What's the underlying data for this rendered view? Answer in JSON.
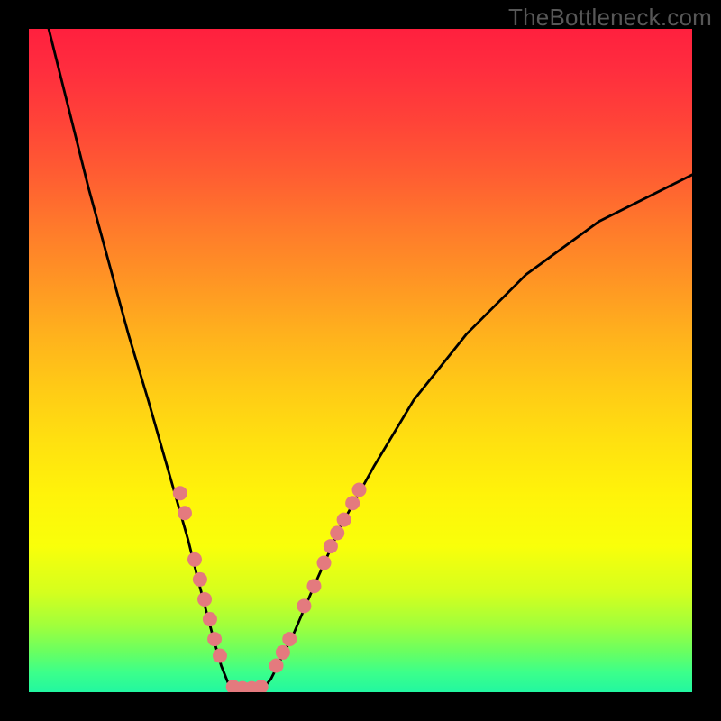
{
  "watermark": "TheBottleneck.com",
  "chart_data": {
    "type": "line",
    "title": "",
    "xlabel": "",
    "ylabel": "",
    "xlim": [
      0,
      100
    ],
    "ylim": [
      0,
      100
    ],
    "background": "rainbow-gradient-red-top-green-bottom",
    "series": [
      {
        "name": "left-curve",
        "x": [
          3,
          6,
          9,
          12,
          15,
          18,
          20,
          22,
          24,
          25.5,
          26.8,
          28,
          29,
          30,
          30.8
        ],
        "y": [
          100,
          88,
          76,
          65,
          54,
          44,
          37,
          30,
          23,
          17,
          12,
          7.5,
          4,
          1.5,
          0.4
        ]
      },
      {
        "name": "valley-floor",
        "x": [
          30.8,
          32,
          33.5,
          35.2
        ],
        "y": [
          0.4,
          0.2,
          0.2,
          0.4
        ]
      },
      {
        "name": "right-curve",
        "x": [
          35.2,
          36.5,
          38,
          40,
          43,
          47,
          52,
          58,
          66,
          75,
          86,
          100
        ],
        "y": [
          0.4,
          2,
          5,
          9,
          16,
          25,
          34,
          44,
          54,
          63,
          71,
          78
        ]
      }
    ],
    "markers": [
      {
        "name": "left-cluster",
        "x": 22.8,
        "y": 30
      },
      {
        "name": "left-cluster",
        "x": 23.5,
        "y": 27
      },
      {
        "name": "left-cluster",
        "x": 25.0,
        "y": 20
      },
      {
        "name": "left-cluster",
        "x": 25.8,
        "y": 17
      },
      {
        "name": "left-cluster",
        "x": 26.5,
        "y": 14
      },
      {
        "name": "left-cluster",
        "x": 27.3,
        "y": 11
      },
      {
        "name": "left-cluster",
        "x": 28.0,
        "y": 8
      },
      {
        "name": "left-cluster",
        "x": 28.8,
        "y": 5.5
      },
      {
        "name": "valley",
        "x": 30.8,
        "y": 0.8
      },
      {
        "name": "valley",
        "x": 32.2,
        "y": 0.6
      },
      {
        "name": "valley",
        "x": 33.6,
        "y": 0.6
      },
      {
        "name": "valley",
        "x": 35.0,
        "y": 0.8
      },
      {
        "name": "right-cluster",
        "x": 37.3,
        "y": 4
      },
      {
        "name": "right-cluster",
        "x": 38.3,
        "y": 6
      },
      {
        "name": "right-cluster",
        "x": 39.3,
        "y": 8
      },
      {
        "name": "right-cluster",
        "x": 41.5,
        "y": 13
      },
      {
        "name": "right-cluster",
        "x": 43.0,
        "y": 16
      },
      {
        "name": "right-cluster",
        "x": 44.5,
        "y": 19.5
      },
      {
        "name": "right-cluster",
        "x": 45.5,
        "y": 22
      },
      {
        "name": "right-cluster",
        "x": 46.5,
        "y": 24
      },
      {
        "name": "right-cluster",
        "x": 47.5,
        "y": 26
      },
      {
        "name": "right-cluster",
        "x": 48.8,
        "y": 28.5
      },
      {
        "name": "right-cluster",
        "x": 49.8,
        "y": 30.5
      }
    ],
    "marker_style": {
      "color": "#e47a7e",
      "radius": 8
    }
  }
}
